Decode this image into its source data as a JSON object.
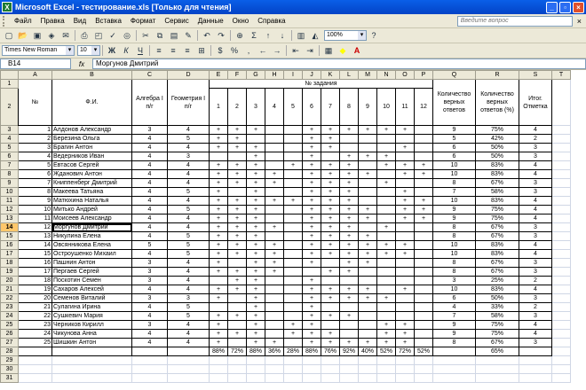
{
  "window": {
    "title": "Microsoft Excel - тестирование.xls  [Только для чтения]",
    "app_icon": "X"
  },
  "menu": {
    "items": [
      "Файл",
      "Правка",
      "Вид",
      "Вставка",
      "Формат",
      "Сервис",
      "Данные",
      "Окно",
      "Справка"
    ],
    "help_placeholder": "Введите вопрос"
  },
  "toolbar": {
    "zoom": "100%",
    "font_name": "Times New Roman",
    "font_size": "10",
    "sum_label": "Σ"
  },
  "formula_bar": {
    "cell_ref": "B14",
    "fx": "fx",
    "content": "Моргунов Дмитрий"
  },
  "columns": [
    "A",
    "B",
    "C",
    "D",
    "E",
    "F",
    "G",
    "H",
    "I",
    "J",
    "K",
    "L",
    "M",
    "N",
    "O",
    "P",
    "Q",
    "R",
    "S",
    "T"
  ],
  "header": {
    "n_label": "№",
    "fio_label": "Ф.И.",
    "algebra_label": "Алгебра I п/г",
    "geometry_label": "Геометрия I п/г",
    "task_label": "№ задания",
    "task_numbers": [
      "1",
      "2",
      "3",
      "4",
      "5",
      "6",
      "7",
      "8",
      "9",
      "10",
      "11",
      "12"
    ],
    "correct_label": "Количество верных ответов",
    "percent_label": "Количество верных ответов (%)",
    "grade_label": "Итог. Отметка"
  },
  "students": [
    {
      "n": "1",
      "name": "Алдонов Александр",
      "alg": "3",
      "geo": "4",
      "t": [
        "+",
        "+",
        "+",
        "",
        "",
        "+",
        "+",
        "+",
        "+",
        "+",
        "+",
        ""
      ],
      "c": "9",
      "p": "75%",
      "g": "4"
    },
    {
      "n": "2",
      "name": "Березина Ольга",
      "alg": "4",
      "geo": "5",
      "t": [
        "+",
        "+",
        "",
        "",
        "",
        "+",
        "+",
        "",
        "",
        "",
        "",
        ""
      ],
      "c": "5",
      "p": "42%",
      "g": "2"
    },
    {
      "n": "3",
      "name": "Брагин Антон",
      "alg": "4",
      "geo": "4",
      "t": [
        "+",
        "+",
        "+",
        "",
        "",
        "+",
        "+",
        "",
        "",
        "",
        "+",
        ""
      ],
      "c": "6",
      "p": "50%",
      "g": "3"
    },
    {
      "n": "4",
      "name": "Ведерников Иван",
      "alg": "4",
      "geo": "3",
      "t": [
        "",
        "",
        "+",
        "",
        "",
        "+",
        "",
        "+",
        "+",
        "+",
        "",
        ""
      ],
      "c": "6",
      "p": "50%",
      "g": "3"
    },
    {
      "n": "5",
      "name": "Евтасов Сергей",
      "alg": "4",
      "geo": "4",
      "t": [
        "+",
        "+",
        "+",
        "",
        "+",
        "+",
        "+",
        "+",
        "",
        "+",
        "+",
        "+"
      ],
      "c": "10",
      "p": "83%",
      "g": "4"
    },
    {
      "n": "6",
      "name": "Жданович Антон",
      "alg": "4",
      "geo": "4",
      "t": [
        "+",
        "+",
        "+",
        "+",
        "",
        "+",
        "+",
        "+",
        "+",
        "",
        "+",
        "+"
      ],
      "c": "10",
      "p": "83%",
      "g": "4"
    },
    {
      "n": "7",
      "name": "Книппенберг Дмитрий",
      "alg": "4",
      "geo": "4",
      "t": [
        "+",
        "+",
        "+",
        "+",
        "",
        "+",
        "+",
        "+",
        "",
        "+",
        "",
        ""
      ],
      "c": "8",
      "p": "67%",
      "g": "3"
    },
    {
      "n": "8",
      "name": "Макеева Татьяна",
      "alg": "4",
      "geo": "5",
      "t": [
        "+",
        "",
        "+",
        "",
        "",
        "+",
        "+",
        "+",
        "",
        "",
        "+",
        ""
      ],
      "c": "7",
      "p": "58%",
      "g": "3"
    },
    {
      "n": "9",
      "name": "Матюхина Наталья",
      "alg": "4",
      "geo": "4",
      "t": [
        "+",
        "+",
        "+",
        "+",
        "+",
        "+",
        "+",
        "+",
        "",
        "",
        "+",
        "+"
      ],
      "c": "10",
      "p": "83%",
      "g": "4"
    },
    {
      "n": "10",
      "name": "Митько Андрей",
      "alg": "4",
      "geo": "5",
      "t": [
        "+",
        "+",
        "+",
        "",
        "",
        "+",
        "+",
        "+",
        "+",
        "",
        "+",
        "+"
      ],
      "c": "9",
      "p": "75%",
      "g": "4"
    },
    {
      "n": "11",
      "name": "Моисеев Александр",
      "alg": "4",
      "geo": "4",
      "t": [
        "+",
        "+",
        "+",
        "",
        "",
        "+",
        "+",
        "+",
        "+",
        "",
        "+",
        "+"
      ],
      "c": "9",
      "p": "75%",
      "g": "4"
    },
    {
      "n": "12",
      "name": "Моргунов Дмитрий",
      "alg": "4",
      "geo": "4",
      "t": [
        "+",
        "+",
        "+",
        "+",
        "",
        "+",
        "+",
        "+",
        "",
        "+",
        "",
        ""
      ],
      "c": "8",
      "p": "67%",
      "g": "3"
    },
    {
      "n": "13",
      "name": "Никулина Елена",
      "alg": "4",
      "geo": "5",
      "t": [
        "+",
        "+",
        "+",
        "",
        "",
        "+",
        "+",
        "+",
        "+",
        "",
        "",
        ""
      ],
      "c": "8",
      "p": "67%",
      "g": "3"
    },
    {
      "n": "14",
      "name": "Овсянникова Елена",
      "alg": "5",
      "geo": "5",
      "t": [
        "+",
        "+",
        "+",
        "+",
        "",
        "+",
        "+",
        "+",
        "+",
        "+",
        "+",
        ""
      ],
      "c": "10",
      "p": "83%",
      "g": "4"
    },
    {
      "n": "15",
      "name": "Остроушенко Михаил",
      "alg": "4",
      "geo": "5",
      "t": [
        "+",
        "+",
        "+",
        "+",
        "",
        "+",
        "+",
        "+",
        "+",
        "+",
        "+",
        ""
      ],
      "c": "10",
      "p": "83%",
      "g": "4"
    },
    {
      "n": "16",
      "name": "Пашнин Антон",
      "alg": "3",
      "geo": "4",
      "t": [
        "+",
        "",
        "+",
        "+",
        "",
        "+",
        "",
        "+",
        "+",
        "",
        "",
        ""
      ],
      "c": "8",
      "p": "67%",
      "g": "3"
    },
    {
      "n": "17",
      "name": "Пергаев Сергей",
      "alg": "3",
      "geo": "4",
      "t": [
        "+",
        "+",
        "+",
        "+",
        "",
        "",
        "+",
        "+",
        "",
        "",
        "",
        ""
      ],
      "c": "8",
      "p": "67%",
      "g": "3"
    },
    {
      "n": "18",
      "name": "Поскотин Семен",
      "alg": "3",
      "geo": "4",
      "t": [
        "",
        "+",
        "+",
        "",
        "",
        "+",
        "",
        "",
        "",
        "",
        "",
        ""
      ],
      "c": "3",
      "p": "25%",
      "g": "2"
    },
    {
      "n": "19",
      "name": "Сахаров Алексей",
      "alg": "4",
      "geo": "4",
      "t": [
        "+",
        "+",
        "+",
        "",
        "",
        "+",
        "+",
        "+",
        "+",
        "",
        "+",
        ""
      ],
      "c": "10",
      "p": "83%",
      "g": "4"
    },
    {
      "n": "20",
      "name": "Семенов Виталий",
      "alg": "3",
      "geo": "3",
      "t": [
        "+",
        "",
        "+",
        "",
        "",
        "+",
        "+",
        "+",
        "+",
        "+",
        "",
        ""
      ],
      "c": "6",
      "p": "50%",
      "g": "3"
    },
    {
      "n": "21",
      "name": "Сулагина Ирина",
      "alg": "4",
      "geo": "5",
      "t": [
        "",
        "",
        "+",
        "",
        "",
        "+",
        "",
        "",
        "",
        "",
        "",
        ""
      ],
      "c": "4",
      "p": "33%",
      "g": "2"
    },
    {
      "n": "22",
      "name": "Сушкевич Мария",
      "alg": "4",
      "geo": "5",
      "t": [
        "+",
        "+",
        "+",
        "",
        "",
        "+",
        "+",
        "+",
        "",
        "",
        "",
        ""
      ],
      "c": "7",
      "p": "58%",
      "g": "3"
    },
    {
      "n": "23",
      "name": "Черников Кирилл",
      "alg": "3",
      "geo": "4",
      "t": [
        "+",
        "",
        "+",
        "",
        "+",
        "+",
        "",
        "",
        "",
        "+",
        "+",
        ""
      ],
      "c": "9",
      "p": "75%",
      "g": "4"
    },
    {
      "n": "24",
      "name": "Чикунова Анна",
      "alg": "4",
      "geo": "4",
      "t": [
        "+",
        "+",
        "+",
        "",
        "+",
        "+",
        "+",
        "",
        "",
        "+",
        "+",
        ""
      ],
      "c": "9",
      "p": "75%",
      "g": "4"
    },
    {
      "n": "25",
      "name": "Шишкин Антон",
      "alg": "4",
      "geo": "4",
      "t": [
        "+",
        "",
        "+",
        "+",
        "",
        "+",
        "+",
        "+",
        "+",
        "+",
        "+",
        ""
      ],
      "c": "8",
      "p": "67%",
      "g": "3"
    }
  ],
  "totals": {
    "task_percents": [
      "88%",
      "72%",
      "88%",
      "36%",
      "28%",
      "88%",
      "76%",
      "92%",
      "40%",
      "52%",
      "72%",
      "52%"
    ],
    "overall_percent": "65%"
  },
  "row_numbers": [
    "1",
    "2",
    "3",
    "4",
    "5",
    "6",
    "7",
    "8",
    "9",
    "10",
    "11",
    "12",
    "13",
    "14",
    "15",
    "16",
    "17",
    "18",
    "19",
    "20",
    "21",
    "22",
    "23",
    "24",
    "25",
    "26",
    "27",
    "28",
    "29",
    "30",
    "31"
  ],
  "selected_row": "14"
}
